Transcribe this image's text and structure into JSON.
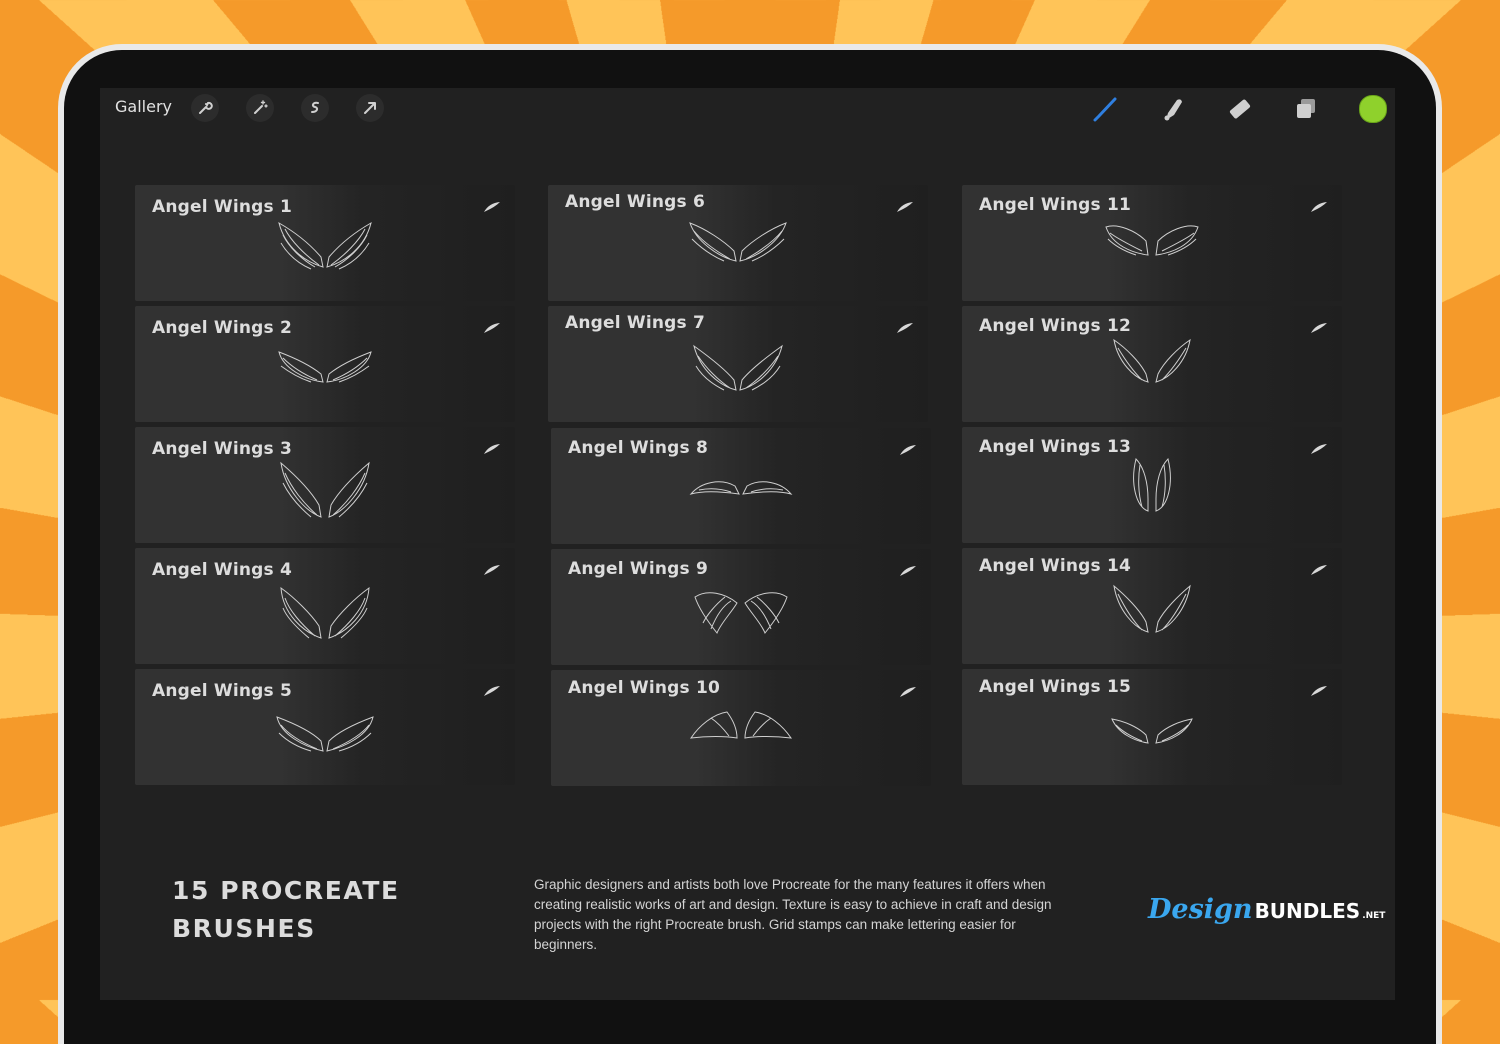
{
  "app": {
    "gallery_label": "Gallery",
    "left_tools": [
      "wrench-icon",
      "magic-wand-icon",
      "selection-icon",
      "transform-arrow-icon"
    ],
    "right_tools": [
      "brush-icon",
      "smudge-icon",
      "eraser-icon",
      "layers-icon"
    ],
    "active_color": "#8fd12c",
    "brush_tool_color": "#2f7fe0"
  },
  "brushes": {
    "column1": [
      "Angel Wings 1",
      "Angel Wings 2",
      "Angel Wings 3",
      "Angel Wings 4",
      "Angel Wings 5"
    ],
    "column2": [
      "Angel Wings 6",
      "Angel Wings 7",
      "Angel Wings 8",
      "Angel Wings 9",
      "Angel Wings 10"
    ],
    "column3": [
      "Angel Wings 11",
      "Angel Wings 12",
      "Angel Wings 13",
      "Angel Wings 14",
      "Angel Wings 15"
    ]
  },
  "footer": {
    "title_line1": "15 PROCREATE",
    "title_line2": "BRUSHES",
    "description": "Graphic designers and artists both love Procreate for the many features it offers when creating realistic works of art and design. Texture is easy to achieve in craft and design projects with the right Procreate brush. Grid stamps can make lettering easier for beginners."
  },
  "logo": {
    "part1": "Design",
    "part2": "BUNDLES",
    "part3": ".NET"
  },
  "colors": {
    "sunburst_dark": "#f59a2a",
    "sunburst_light": "#ffc458",
    "screen_bg": "#212121",
    "logo_blue": "#3aa7ef"
  }
}
